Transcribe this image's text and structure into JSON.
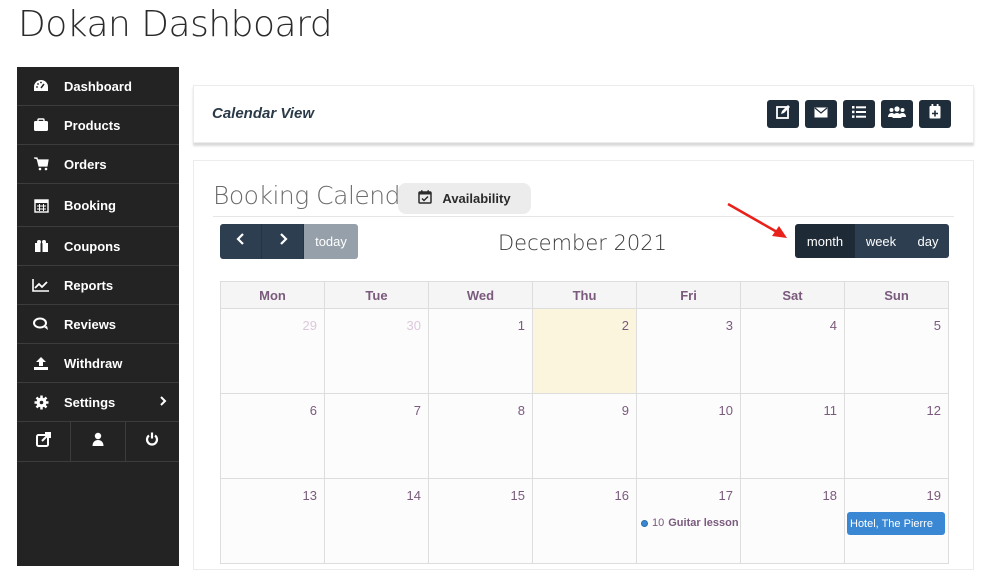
{
  "page": {
    "title": "Dokan Dashboard"
  },
  "sidebar": {
    "items": [
      {
        "label": "Dashboard",
        "icon": "tachometer-icon"
      },
      {
        "label": "Products",
        "icon": "briefcase-icon"
      },
      {
        "label": "Orders",
        "icon": "cart-icon"
      },
      {
        "label": "Booking",
        "icon": "calendar-icon"
      },
      {
        "label": "Coupons",
        "icon": "gift-icon"
      },
      {
        "label": "Reports",
        "icon": "line-chart-icon"
      },
      {
        "label": "Reviews",
        "icon": "comments-icon"
      },
      {
        "label": "Withdraw",
        "icon": "upload-icon"
      },
      {
        "label": "Settings",
        "icon": "gear-icon",
        "has_submenu": true
      }
    ],
    "bottom": [
      "external-link-icon",
      "user-icon",
      "power-icon"
    ]
  },
  "header": {
    "title": "Calendar View",
    "toolbar": [
      "edit-icon",
      "envelope-icon",
      "list-icon",
      "users-icon",
      "calendar-plus-icon"
    ]
  },
  "calendar": {
    "title": "Booking Calendar",
    "availability_label": "Availability",
    "today_label": "today",
    "month_title": "December 2021",
    "views": [
      "month",
      "week",
      "day"
    ],
    "active_view": "month",
    "weekdays": [
      "Mon",
      "Tue",
      "Wed",
      "Thu",
      "Fri",
      "Sat",
      "Sun"
    ],
    "weeks": [
      [
        {
          "d": "29",
          "other": true
        },
        {
          "d": "30",
          "other": true
        },
        {
          "d": "1"
        },
        {
          "d": "2",
          "today": true
        },
        {
          "d": "3"
        },
        {
          "d": "4"
        },
        {
          "d": "5"
        }
      ],
      [
        {
          "d": "6"
        },
        {
          "d": "7"
        },
        {
          "d": "8"
        },
        {
          "d": "9"
        },
        {
          "d": "10"
        },
        {
          "d": "11"
        },
        {
          "d": "12"
        }
      ],
      [
        {
          "d": "13"
        },
        {
          "d": "14"
        },
        {
          "d": "15"
        },
        {
          "d": "16"
        },
        {
          "d": "17",
          "event": {
            "type": "dot",
            "time": "10",
            "title": "Guitar lesson"
          }
        },
        {
          "d": "18"
        },
        {
          "d": "19",
          "event": {
            "type": "block",
            "title": "Hotel, The Pierre"
          }
        }
      ]
    ],
    "colors": {
      "event": "#3a87d3",
      "today_bg": "#fcf5de",
      "dark_button": "#2c3e50"
    }
  }
}
